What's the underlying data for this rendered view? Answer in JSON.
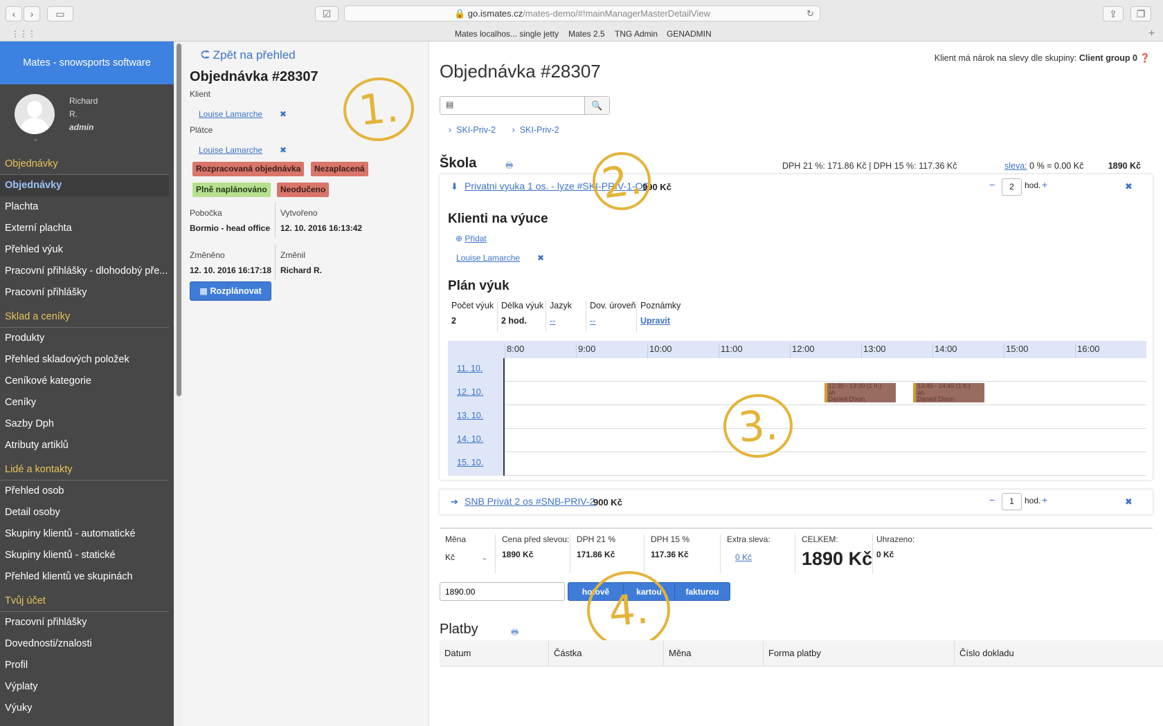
{
  "browser": {
    "url_host": "go.ismates.cz",
    "url_path": "/mates-demo/#!mainManagerMasterDetailView",
    "bookmarks": [
      "Mates localhos... single jetty",
      "Mates 2.5",
      "TNG Admin",
      "GENADMIN"
    ]
  },
  "sidebar": {
    "brand": "Mates - snowsports software",
    "user_first": "Richard",
    "user_last": "R.",
    "user_role": "admin",
    "sections": [
      {
        "title": "Objednávky",
        "items": [
          "Objednávky",
          "Plachta",
          "Externí plachta",
          "Přehled výuk",
          "Pracovní přihlášky - dlohodobý pře...",
          "Pracovní přihlášky"
        ]
      },
      {
        "title": "Sklad a ceníky",
        "items": [
          "Produkty",
          "Přehled skladových položek",
          "Ceníkové kategorie",
          "Ceníky",
          "Sazby Dph",
          "Atributy artiklů"
        ]
      },
      {
        "title": "Lidé a kontakty",
        "items": [
          "Přehled osob",
          "Detail osoby",
          "Skupiny klientů - automatické",
          "Skupiny klientů - statické",
          "Přehled klientů ve skupinách"
        ]
      },
      {
        "title": "Tvůj účet",
        "items": [
          "Pracovní přihlášky",
          "Dovednosti/znalosti",
          "Profil",
          "Výplaty",
          "Výuky"
        ]
      }
    ]
  },
  "detail": {
    "back_link": "Zpět na přehled",
    "title": "Objednávka #28307",
    "client_label": "Klient",
    "client_name": "Louise Lamarche",
    "payer_label": "Plátce",
    "payer_name": "Louise Lamarche",
    "tags": [
      "Rozpracovaná objednávka",
      "Nezaplacená",
      "Plně naplánováno",
      "Neodučeno"
    ],
    "branch_label": "Pobočka",
    "branch_value": "Bormio - head office",
    "created_label": "Vytvořeno",
    "created_value": "12. 10. 2016 16:13:42",
    "changed_label": "Změněno",
    "changed_value": "12. 10. 2016 16:17:18",
    "changed_by_label": "Změnil",
    "changed_by_value": "Richard R.",
    "plan_button": "Rozplánovat",
    "annotation": "1."
  },
  "main": {
    "title": "Objednávka #28307",
    "client_group_prefix": "Klient má nárok na slevy dle skupiny:",
    "client_group": "Client group 0",
    "crumbs": [
      "SKI-Priv-2",
      "SKI-Priv-2"
    ],
    "school": {
      "title": "Škola",
      "vat21": "DPH 21 %: 171.86 Kč | DPH 15 %: 117.36 Kč",
      "discount_link": "sleva:",
      "discount_value": "0 % = 0.00 Kč",
      "total": "1890 Kč"
    },
    "item1": {
      "name": "Privatni vyuka 1 os. - lyze #SKI-PRIV-1-OS",
      "price": "990 Kč",
      "qty": "2",
      "unit": "hod.",
      "clients_title": "Klienti na výuce",
      "add_label": "Přidat",
      "client": "Louise Lamarche",
      "plan_title": "Plán výuk",
      "plan_headers": [
        "Počet výuk",
        "Délka výuk",
        "Jazyk",
        "Dov. úroveň",
        "Poznámky"
      ],
      "plan_values": [
        "2",
        "2 hod.",
        "--",
        "--",
        "Upravit"
      ],
      "hours": [
        "8:00",
        "9:00",
        "10:00",
        "11:00",
        "12:00",
        "13:00",
        "14:00",
        "15:00",
        "16:00"
      ],
      "days": [
        "11. 10.",
        "12. 10.",
        "13. 10.",
        "14. 10.",
        "15. 10."
      ],
      "lessons": [
        {
          "day": 1,
          "start": 12.5,
          "end": 13.5,
          "line1": "12:30 - 13:30 (1 h.)",
          "line2": "ah",
          "line3": "Daniell Dixon"
        },
        {
          "day": 1,
          "start": 13.75,
          "end": 14.75,
          "line1": "13:45 - 14:45 (1 h.)",
          "line2": "ah",
          "line3": "Daniell Dixon"
        }
      ],
      "annotation2": "2.",
      "annotation3": "3."
    },
    "item2": {
      "name": "SNB Privát 2 os #SNB-PRIV-2",
      "price": "900 Kč",
      "qty": "1",
      "unit": "hod."
    },
    "totals": {
      "currency_label": "Měna",
      "currency_value": "Kč",
      "price_before_label": "Cena před slevou:",
      "price_before_value": "1890 Kč",
      "vat21_label": "DPH 21 %",
      "vat21_value": "171.86 Kč",
      "vat15_label": "DPH 15 %",
      "vat15_value": "117.36 Kč",
      "extra_label": "Extra sleva:",
      "extra_value": "0 Kč",
      "total_label": "CELKEM:",
      "total_value": "1890 Kč",
      "paid_label": "Uhrazeno:",
      "paid_value": "0 Kč",
      "amount_input": "1890.00",
      "pay_cash": "hotově",
      "pay_card": "kartou",
      "pay_invoice": "fakturou",
      "annotation4": "4."
    },
    "payments": {
      "title": "Platby",
      "headers": [
        "Datum",
        "Částka",
        "Měna",
        "Forma platby",
        "Číslo dokladu"
      ]
    }
  }
}
